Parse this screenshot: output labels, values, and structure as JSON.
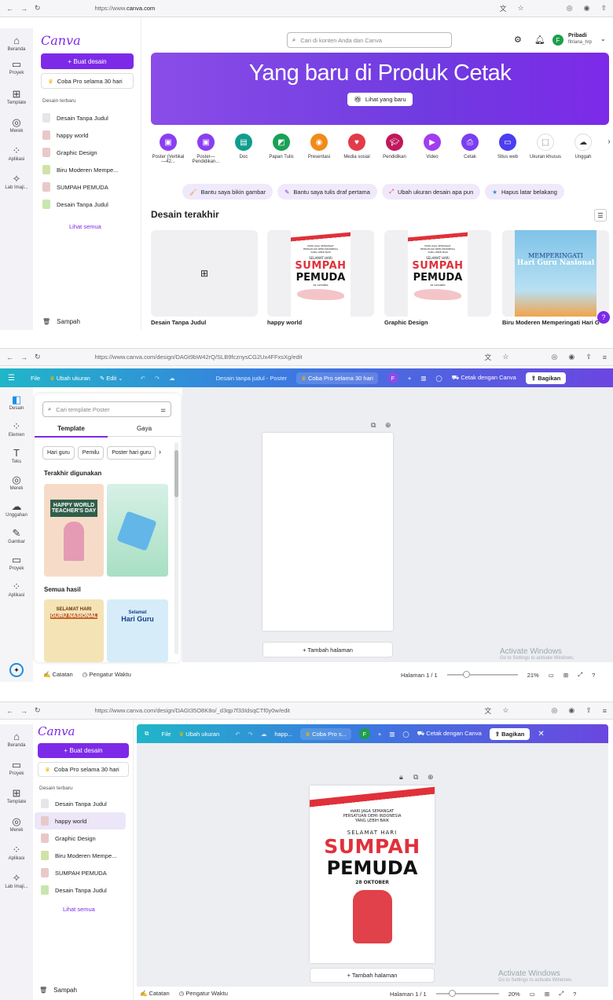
{
  "shot1": {
    "url_prefix": "https://www.",
    "url_host": "canva.com",
    "logo": "Canva",
    "search_placeholder": "Cari di konten Anda dan Canva",
    "user_name": "Pribadi",
    "user_handle": "fitriana_hrp",
    "avatar_letter": "F",
    "rail": [
      "Beranda",
      "Proyek",
      "Template",
      "Merek",
      "Aplikasi",
      "Lab Imaji..."
    ],
    "create_button": "+ Buat desain",
    "trial_button": "Coba Pro selama 30 hari",
    "recent_heading": "Desain terbaru",
    "recent": [
      "Desain Tanpa Judul",
      "happy world",
      "Graphic Design",
      "Biru Moderen Mempe...",
      "SUMPAH PEMUDA",
      "Desain Tanpa Judul"
    ],
    "see_all": "Lihat semua",
    "trash": "Sampah",
    "hero_title": "Yang baru di Produk Cetak",
    "hero_button": "Lihat yang baru",
    "categories": [
      "Poster (Vertikal—42...",
      "Poster—Pendidikan...",
      "Doc",
      "Papan Tulis",
      "Presentasi",
      "Media sosial",
      "Pendidikan",
      "Video",
      "Cetak",
      "Situs web",
      "Ukuran khusus",
      "Unggah"
    ],
    "category_colors": [
      "#8b3ef0",
      "#8b3ef0",
      "#0f9d8e",
      "#1aa157",
      "#f08a1a",
      "#e23b4a",
      "#c0185b",
      "#a03ef0",
      "#7b3ef0",
      "#4b3ef0",
      "#ffffff",
      "#ffffff"
    ],
    "chips": [
      "Bantu saya bikin gambar",
      "Bantu saya tulis draf pertama",
      "Ubah ukuran desain apa pun",
      "Hapus latar belakang"
    ],
    "recent_designs_heading": "Desain terakhir",
    "designs": [
      "Desain Tanpa Judul",
      "happy world",
      "Graphic Design",
      "Biru Moderen Memperingati Hari G"
    ],
    "poster_small": "MARI JAGA SEMANGAT PERSATUAN DEMI INDONESIA YANG LEBIH BAIK",
    "poster_selamat": "SELAMAT HARI",
    "poster_sumpah": "SUMPAH",
    "poster_pemuda": "PEMUDA",
    "poster_date": "28 OKTOBER",
    "blue_card_title": "MEMPERINGATI",
    "blue_card_sub": "Hari Guru Nasional",
    "help": "?"
  },
  "shot2": {
    "url": "https://www.canva.com/design/DAGt9bW42rQ/SLB9fcznysCG2Ux4FFxsXg/edit",
    "file": "File",
    "resize": "Ubah ukuran",
    "edit": "Edit",
    "doc_title": "Desain tanpa judul - Poster",
    "trial": "Coba Pro selama 30 hari",
    "avatar": "F",
    "print": "Cetak dengan Canva",
    "share": "Bagikan",
    "rail": [
      "Desain",
      "Elemen",
      "Teks",
      "Merek",
      "Unggahan",
      "Gambar",
      "Proyek",
      "Aplikasi"
    ],
    "search_placeholder": "Cari template Poster",
    "tab_template": "Template",
    "tab_style": "Gaya",
    "filters": [
      "Hari guru",
      "Pemilu",
      "Poster hari guru"
    ],
    "recent_used": "Terakhir digunakan",
    "all_results": "Semua hasil",
    "tmpl_teacher_small": "HAPPY WORLD",
    "tmpl_teacher": "TEACHER'S DAY",
    "tmpl_guru1": "SELAMAT HARI",
    "tmpl_guru2": "GURU NASIONAL",
    "tmpl_guru3": "Selamat",
    "tmpl_guru4": "Hari Guru",
    "add_page": "+ Tambah halaman",
    "notes": "Catatan",
    "timer": "Pengatur Waktu",
    "page_indicator": "Halaman 1 / 1",
    "zoom": "21%",
    "activate_title": "Activate Windows",
    "activate_sub": "Go to Settings to activate Windows."
  },
  "shot3": {
    "url": "https://www.canva.com/design/DAGt35O8K8o/_d3qp7f33IdsqCTf0y0w/edit",
    "logo": "Canva",
    "rail": [
      "Beranda",
      "Proyek",
      "Template",
      "Merek",
      "Aplikasi",
      "Lab Imaji..."
    ],
    "create_button": "+ Buat desain",
    "trial_button": "Coba Pro selama 30 hari",
    "recent_heading": "Desain terbaru",
    "recent": [
      "Desain Tanpa Judul",
      "happy world",
      "Graphic Design",
      "Biru Moderen Mempe...",
      "SUMPAH PEMUDA",
      "Desain Tanpa Judul"
    ],
    "see_all": "Lihat semua",
    "trash": "Sampah",
    "file": "File",
    "resize": "Ubah ukuran",
    "doc_title": "happ...",
    "trial": "Coba Pro s...",
    "avatar": "F",
    "print": "Cetak dengan Canva",
    "share": "Bagikan",
    "poster_small": "MARI JAGA SEMANGAT PERSATUAN DEMI INDONESIA YANG LEBIH BAIK",
    "poster_selamat": "SELAMAT HARI",
    "poster_sumpah": "SUMPAH",
    "poster_pemuda": "PEMUDA",
    "poster_date": "28 OKTOBER",
    "add_page": "+ Tambah halaman",
    "notes": "Catatan",
    "timer": "Pengatur Waktu",
    "page_indicator": "Halaman 1 / 1",
    "zoom": "20%",
    "activate_title": "Activate Windows",
    "activate_sub": "Go to Settings to activate Windows."
  }
}
